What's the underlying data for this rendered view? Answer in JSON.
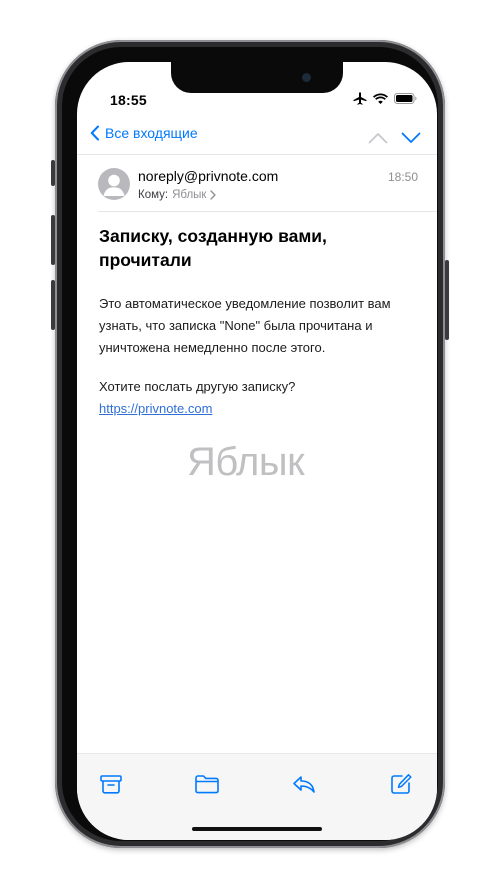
{
  "status_bar": {
    "time": "18:55"
  },
  "nav": {
    "back_label": "Все входящие"
  },
  "message": {
    "sender": "noreply@privnote.com",
    "to_label": "Кому:",
    "to_name": "Яблык",
    "time": "18:50",
    "subject": "Записку, созданную вами, прочитали",
    "body_paragraph_1": "Это автоматическое уведомление позволит вам узнать, что записка \"None\" была прочитана и уничтожена немедленно после этого.",
    "body_paragraph_2": "Хотите послать другую записку?",
    "link": "https://privnote.com"
  },
  "watermark": "Яблык",
  "toolbar": {
    "icons": [
      "archive-icon",
      "folder-icon",
      "reply-icon",
      "compose-icon"
    ]
  },
  "colors": {
    "accent": "#007aff",
    "link": "#2f6fd6",
    "secondary_text": "#8e8e93"
  }
}
